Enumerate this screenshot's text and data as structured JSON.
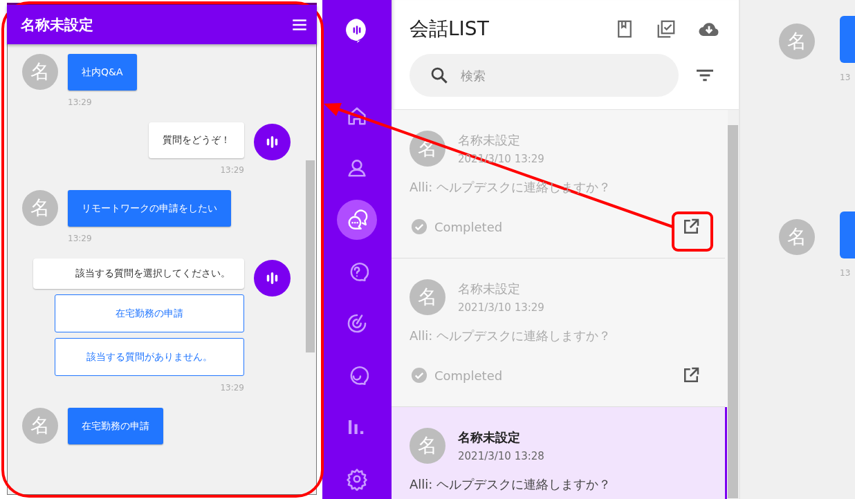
{
  "chat_window": {
    "title": "名称未設定",
    "messages": [
      {
        "kind": "user",
        "avatar": "名",
        "text": "社内Q&A",
        "time": "13:29"
      },
      {
        "kind": "bot",
        "text": "質問をどうぞ！",
        "time": "13:29"
      },
      {
        "kind": "user",
        "avatar": "名",
        "text": "リモートワークの申請をしたい",
        "time": "13:29"
      },
      {
        "kind": "bot",
        "text": "該当する質問を選択してください。",
        "options": [
          "在宅勤務の申請",
          "該当する質問がありません。"
        ],
        "time": "13:29"
      },
      {
        "kind": "user",
        "avatar": "名",
        "text": "在宅勤務の申請"
      }
    ]
  },
  "nav": {
    "items": [
      {
        "kind": "home",
        "selected": false
      },
      {
        "kind": "person",
        "selected": false
      },
      {
        "kind": "chats",
        "selected": true
      },
      {
        "kind": "help",
        "selected": false
      },
      {
        "kind": "radar",
        "selected": false
      },
      {
        "kind": "smile",
        "selected": false
      },
      {
        "kind": "chart",
        "selected": false
      },
      {
        "kind": "gear",
        "selected": false
      }
    ]
  },
  "conversation_list": {
    "title": "会話LIST",
    "search": {
      "placeholder": "検索"
    },
    "items": [
      {
        "avatar": "名",
        "name": "名称未設定",
        "datetime": "2021/3/10 13:29",
        "preview": "Alli: ヘルプデスクに連絡しますか？",
        "status": "Completed",
        "selected": false
      },
      {
        "avatar": "名",
        "name": "名称未設定",
        "datetime": "2021/3/10 13:29",
        "preview": "Alli: ヘルプデスクに連絡しますか？",
        "status": "Completed",
        "selected": false
      },
      {
        "avatar": "名",
        "name": "名称未設定",
        "datetime": "2021/3/10 13:28",
        "preview": "Alli: ヘルプデスクに連絡しますか？",
        "selected": true
      }
    ]
  },
  "detail_panel": {
    "messages": [
      {
        "avatar": "名",
        "time": "13"
      },
      {
        "avatar": "名",
        "time": "13"
      }
    ]
  }
}
